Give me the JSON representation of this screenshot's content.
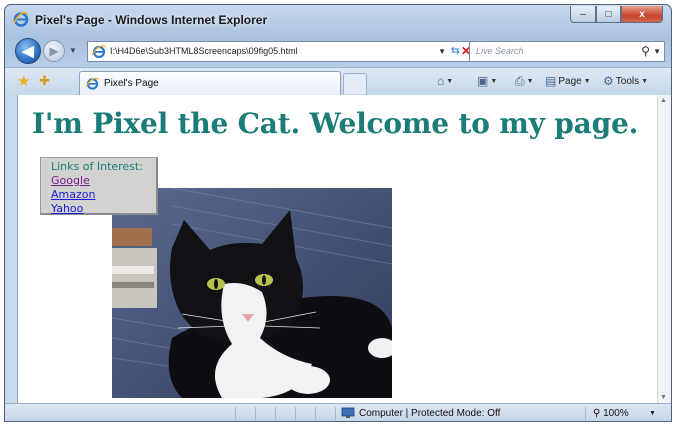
{
  "window": {
    "title": "Pixel's Page - Windows Internet Explorer",
    "min_glyph": "–",
    "max_glyph": "□",
    "close_glyph": "x"
  },
  "navbar": {
    "back_glyph": "◀",
    "forward_glyph": "▶",
    "address": "I:\\H4D6e\\Sub3HTML8Screencaps\\09fig05.html",
    "search_placeholder": "Live Search"
  },
  "tabbar": {
    "tab_label": "Pixel's Page",
    "page_menu": "Page",
    "tools_menu": "Tools"
  },
  "page": {
    "heading": "I'm Pixel the Cat. Welcome to my page.",
    "links_title": "Links of Interest:",
    "links": [
      "Google",
      "Amazon",
      "Yahoo"
    ]
  },
  "statusbar": {
    "zone": "Computer | Protected Mode: Off",
    "zoom": "100%"
  },
  "colors": {
    "heading": "#1b7c78",
    "link": "#1a1ad8",
    "visited_link": "#7a1a8c",
    "links_box_bg": "#d2d2d0"
  }
}
